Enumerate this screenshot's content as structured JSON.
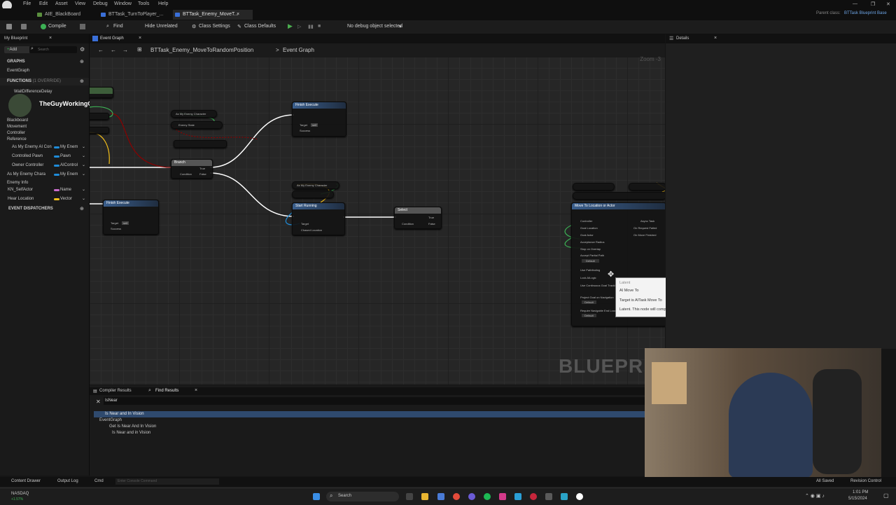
{
  "menu": {
    "items": [
      "File",
      "Edit",
      "Asset",
      "View",
      "Debug",
      "Window",
      "Tools",
      "Help"
    ]
  },
  "doc_tabs": [
    {
      "label": "AIE_BlackBoard"
    },
    {
      "label": "BTTask_TurnToPlayer_..."
    },
    {
      "label": "BTTask_Enemy_MoveT..."
    }
  ],
  "parent_class": {
    "label": "Parent class:",
    "value": "BTTask Blueprint Base"
  },
  "toolbar": {
    "compile": "Compile",
    "find": "Find",
    "hide_unrelated": "Hide Unrelated",
    "class_settings": "Class Settings",
    "class_defaults": "Class Defaults",
    "debug_object": "No debug object selected"
  },
  "my_blueprint": {
    "tab": "My Blueprint",
    "add": "Add",
    "search_placeholder": "Search",
    "graphs_header": "GRAPHS",
    "event_graph": "EventGraph",
    "functions_header": "FUNCTIONS",
    "functions_count": "(1 OVERRIDE)",
    "function_item": "WaitDifferenceDelay",
    "channel_name": "TheGuyWorkingOnFOY",
    "categories": [
      "Blackboard",
      "Movement",
      "Controller",
      "Reference"
    ],
    "variables": [
      {
        "name": "As My Enemy AI Con",
        "type": "My Enem"
      },
      {
        "name": "Controlled Pawn",
        "type": "Pawn"
      },
      {
        "name": "Owner Controller",
        "type": "AIControl"
      },
      {
        "name": "As My Enemy Chara",
        "type": "My Enem"
      }
    ],
    "enemy_info": "Enemy Info",
    "enemy_vars": [
      {
        "name": "KN_SelfActor",
        "type": "Name"
      },
      {
        "name": "Hear Location",
        "type": "Vector"
      }
    ],
    "event_dispatchers": "EVENT DISPATCHERS"
  },
  "graph": {
    "tab": "Event Graph",
    "breadcrumb_asset": "BTTask_Enemy_MoveToRandomPosition",
    "breadcrumb_sep": ">",
    "breadcrumb_graph": "Event Graph",
    "zoom": "Zoom -3",
    "watermark": "BLUEPRINT",
    "nodes": {
      "finish_execute_1": {
        "title": "Finish Execute",
        "pins": [
          "Target",
          "self",
          "Success"
        ]
      },
      "finish_execute_2": {
        "title": "Finish Execute",
        "pins": [
          "Target",
          "self",
          "Success"
        ]
      },
      "as_my_enemy": {
        "title": "As My Enemy Character",
        "pin": "Enemy State"
      },
      "branch": {
        "title": "Branch",
        "pins": [
          "Condition",
          "True",
          "False"
        ]
      },
      "start_running": {
        "title": "Start Running",
        "pins": [
          "Target",
          "Chased Location"
        ]
      },
      "select": {
        "title": "Select",
        "pins": [
          "Condition",
          "True",
          "False"
        ]
      },
      "move_to": {
        "title": "Move To Location or Actor",
        "pins": [
          "Controller",
          "Goal Location",
          "Goal Actor",
          "Acceptance Radius",
          "Stop on Overlap",
          "Accept Partial Path",
          "Use Pathfinding",
          "Lock AILogic",
          "Use Continuous Goal Tracking",
          "Project Goal on Navigation",
          "Require Navigable End Location"
        ],
        "outputs": [
          "Async Task",
          "On Request Failed",
          "On Move Finished"
        ],
        "defaults": [
          "Default",
          "Default",
          "Default"
        ]
      }
    }
  },
  "tooltip": {
    "line1": "Latent",
    "line2": "AI Move To",
    "line3": "Target is AITask Move To",
    "line4": "Latent. This node will complete at a later time. Latent nodes can only be placed in event graphs"
  },
  "details": {
    "tab": "Details"
  },
  "bottom": {
    "tabs": [
      "Compiler Results",
      "Find Results"
    ],
    "search_value": "IsNear",
    "results": [
      {
        "text": "Is Near and In Vision"
      },
      {
        "text": "EventGraph"
      },
      {
        "text": "Get Is Near And In Vision"
      },
      {
        "text": "Is Near and in Vision"
      }
    ]
  },
  "statusbar": {
    "content_drawer": "Content Drawer",
    "output_log": "Output Log",
    "cmd": "Cmd",
    "console_placeholder": "Enter Console Command",
    "all_saved": "All Saved",
    "revision_control": "Revision Control"
  },
  "taskbar": {
    "stock_name": "NASDAQ",
    "stock_change": "+1.57%",
    "search": "Search",
    "time": "1:01 PM",
    "date": "5/15/2024"
  },
  "colors": {
    "exec": "#ffffff",
    "object_pin": "#1f8cd9",
    "bool_pin": "#8c0000",
    "vector_pin": "#f5c01a",
    "name_pin": "#c86ccd",
    "accent": "#3a6fd8"
  }
}
